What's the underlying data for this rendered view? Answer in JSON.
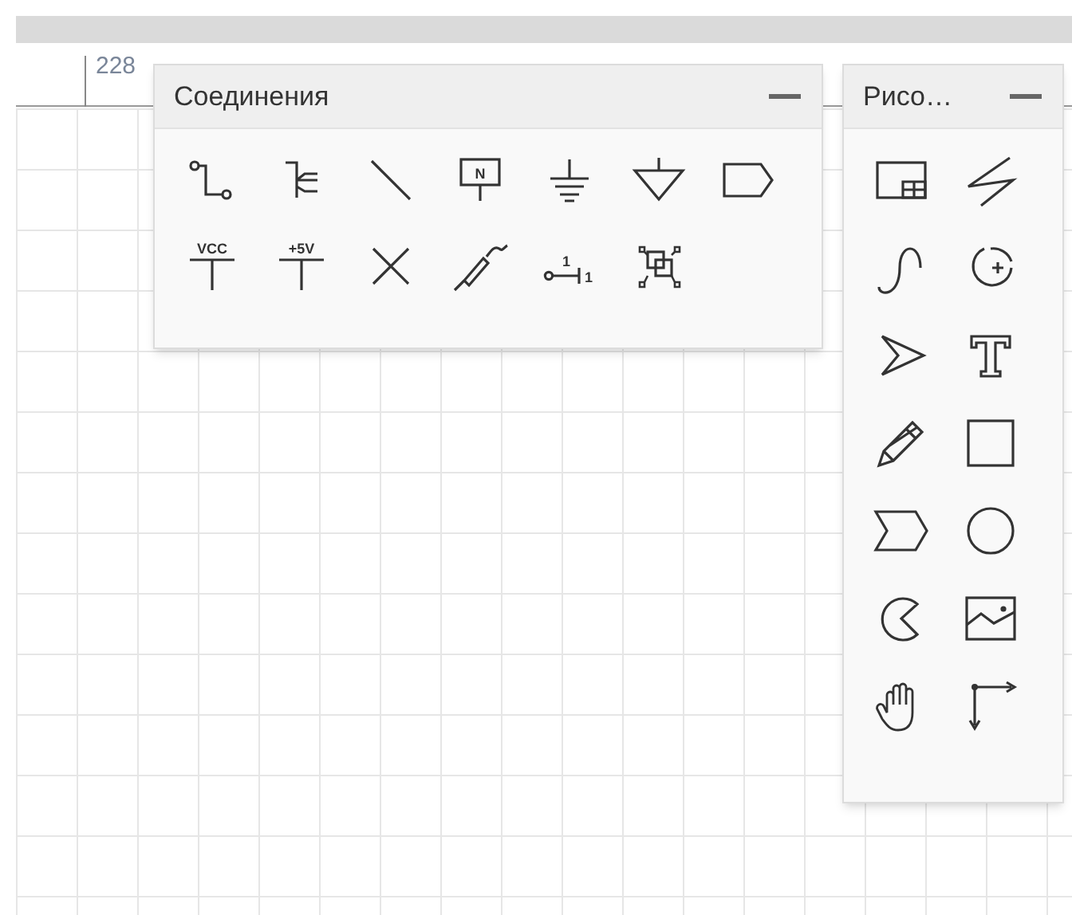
{
  "ruler": {
    "label": "228"
  },
  "panels": [
    {
      "title": "Соединения",
      "tools": [
        {
          "kind": "wire"
        },
        {
          "kind": "bus"
        },
        {
          "kind": "line"
        },
        {
          "kind": "net-port",
          "label": "N"
        },
        {
          "kind": "ground"
        },
        {
          "kind": "signal-ground"
        },
        {
          "kind": "tag"
        },
        {
          "kind": "power",
          "label": "VCC"
        },
        {
          "kind": "power",
          "label": "+5V"
        },
        {
          "kind": "no-connect"
        },
        {
          "kind": "probe"
        },
        {
          "kind": "pin",
          "label": "1",
          "label2": "1"
        },
        {
          "kind": "sheet"
        }
      ]
    },
    {
      "title": "Рисо…",
      "tools": [
        {
          "kind": "table"
        },
        {
          "kind": "zigzag"
        },
        {
          "kind": "curve"
        },
        {
          "kind": "arc"
        },
        {
          "kind": "pointer"
        },
        {
          "kind": "text"
        },
        {
          "kind": "pencil"
        },
        {
          "kind": "rectangle"
        },
        {
          "kind": "chevron"
        },
        {
          "kind": "circle"
        },
        {
          "kind": "pie"
        },
        {
          "kind": "image"
        },
        {
          "kind": "hand"
        },
        {
          "kind": "axes"
        }
      ]
    }
  ]
}
